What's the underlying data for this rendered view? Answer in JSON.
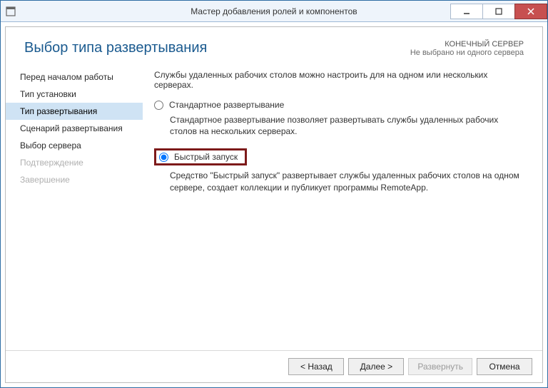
{
  "window": {
    "title": "Мастер добавления ролей и компонентов"
  },
  "header": {
    "title": "Выбор типа развертывания",
    "dest_label": "КОНЕЧНЫЙ СЕРВЕР",
    "dest_value": "Не выбрано ни одного сервера"
  },
  "nav": {
    "items": [
      {
        "label": "Перед началом работы",
        "state": "normal"
      },
      {
        "label": "Тип установки",
        "state": "normal"
      },
      {
        "label": "Тип развертывания",
        "state": "selected"
      },
      {
        "label": "Сценарий развертывания",
        "state": "normal"
      },
      {
        "label": "Выбор сервера",
        "state": "normal"
      },
      {
        "label": "Подтверждение",
        "state": "disabled"
      },
      {
        "label": "Завершение",
        "state": "disabled"
      }
    ]
  },
  "main": {
    "intro": "Службы удаленных рабочих столов можно настроить для на одном или нескольких серверах.",
    "options": [
      {
        "id": "standard",
        "label": "Стандартное развертывание",
        "selected": false,
        "highlighted": false,
        "desc": "Стандартное развертывание позволяет развертывать службы удаленных рабочих столов на нескольких серверах."
      },
      {
        "id": "quick",
        "label": "Быстрый запуск",
        "selected": true,
        "highlighted": true,
        "desc": "Средство \"Быстрый запуск\" развертывает службы удаленных рабочих столов на одном сервере, создает коллекции и публикует программы RemoteApp."
      }
    ]
  },
  "footer": {
    "back": "< Назад",
    "next": "Далее >",
    "deploy": "Развернуть",
    "cancel": "Отмена"
  }
}
